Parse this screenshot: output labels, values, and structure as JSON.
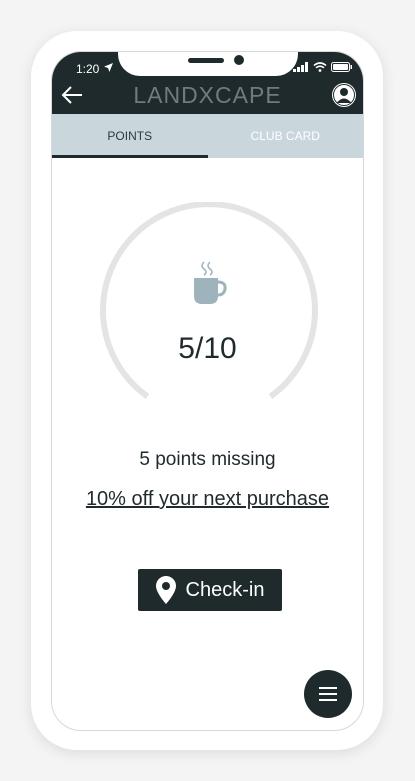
{
  "status_bar": {
    "time": "1:20"
  },
  "header": {
    "title": "LANDXCAPE"
  },
  "tabs": [
    {
      "label": "POINTS",
      "active": true
    },
    {
      "label": "CLUB CARD",
      "active": false
    }
  ],
  "points": {
    "score": "5/10",
    "current": 5,
    "total": 10,
    "missing_text": "5 points missing",
    "offer_text": "10% off your next purchase"
  },
  "checkin": {
    "label": "Check-in"
  },
  "colors": {
    "dark": "#1f2a2c",
    "tab_bar": "#c9d6dc",
    "ring": "#e4e4e4",
    "icon": "#9fb3bd"
  }
}
